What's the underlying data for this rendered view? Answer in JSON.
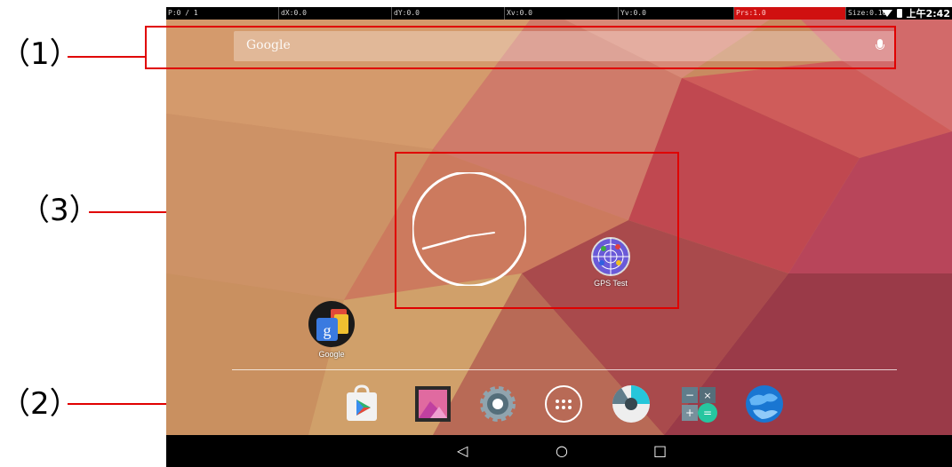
{
  "annotations": {
    "label_1": "（1）",
    "label_2": "（2）",
    "label_3": "（3）"
  },
  "pointer_location": {
    "cells": [
      "P:0 / 1",
      "dX:0.0",
      "dY:0.0",
      "Xv:0.0",
      "Yv:0.0",
      "Prs:1.0",
      "Size:0.10"
    ]
  },
  "status_bar": {
    "time": "上午2:42"
  },
  "search_bar": {
    "logo_text": "Google",
    "mic_icon": "mic-icon"
  },
  "workspace": {
    "apps": [
      {
        "label": "GPS Test",
        "icon": "gps-test-icon"
      },
      {
        "label": "Google",
        "icon": "google-folder-icon"
      }
    ],
    "clock_widget": "analog-clock"
  },
  "dock": {
    "icons": [
      "play-store-icon",
      "gallery-icon",
      "settings-icon",
      "app-drawer-icon",
      "camera-icon",
      "calculator-icon",
      "browser-icon"
    ]
  },
  "nav_bar": {
    "back": "◁",
    "home": "○",
    "recents": "□"
  },
  "colors": {
    "highlight": "#e00000",
    "wallpaper_base": "#c9855d"
  }
}
